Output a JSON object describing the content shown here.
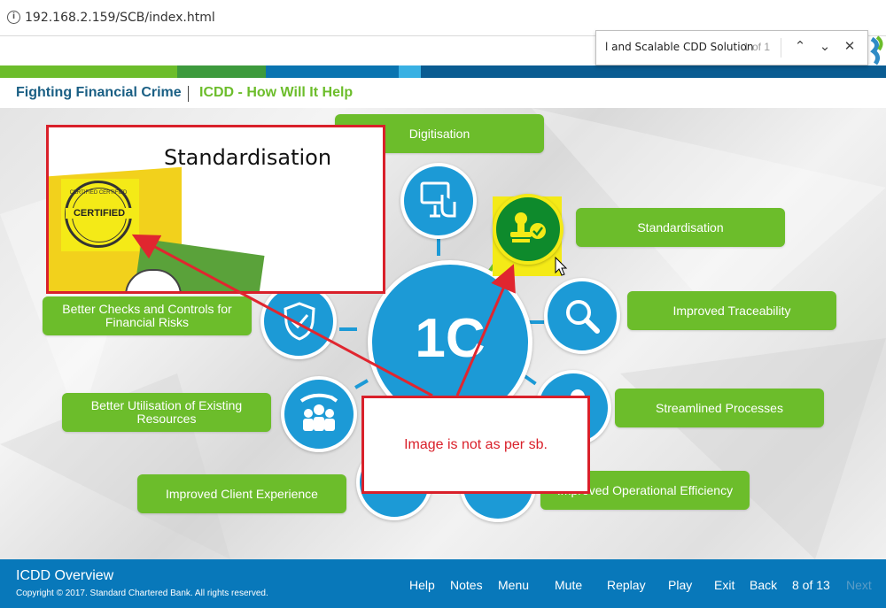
{
  "browser": {
    "url": "192.168.2.159/SCB/index.html"
  },
  "find_bar": {
    "query": "l and Scalable CDD Solution",
    "count": "1 of 1"
  },
  "breadcrumb": {
    "section": "Fighting Financial Crime",
    "page": "ICDD - How Will It Help"
  },
  "colors": {
    "green": "#6cbd2b",
    "blue": "#1c9ad6",
    "dark_blue": "#0878ba",
    "red": "#d9202a"
  },
  "stage": {
    "pills": {
      "digitisation": "Digitisation",
      "standardisation": "Standardisation",
      "traceability": "Improved Traceability",
      "checks": "Better Checks and Controls for Financial Risks",
      "streamlined": "Streamlined Processes",
      "utilisation": "Better Utilisation of Existing Resources",
      "client": "Improved Client Experience",
      "operational": "Improved Operational Efficiency"
    },
    "center_logo": "1C"
  },
  "annotation": {
    "popup_title": "Standardisation",
    "stamp_text": "CERTIFIED",
    "stamp_ring": "CERTIFIED CERTIFIED",
    "comment": "Image is not as per sb."
  },
  "footer": {
    "title": "ICDD Overview",
    "copyright": "Copyright © 2017. Standard Chartered Bank. All rights reserved.",
    "nav": {
      "help": "Help",
      "notes": "Notes",
      "menu": "Menu",
      "mute": "Mute",
      "replay": "Replay",
      "play": "Play",
      "exit": "Exit",
      "back": "Back",
      "page": "8 of 13",
      "next": "Next"
    }
  }
}
